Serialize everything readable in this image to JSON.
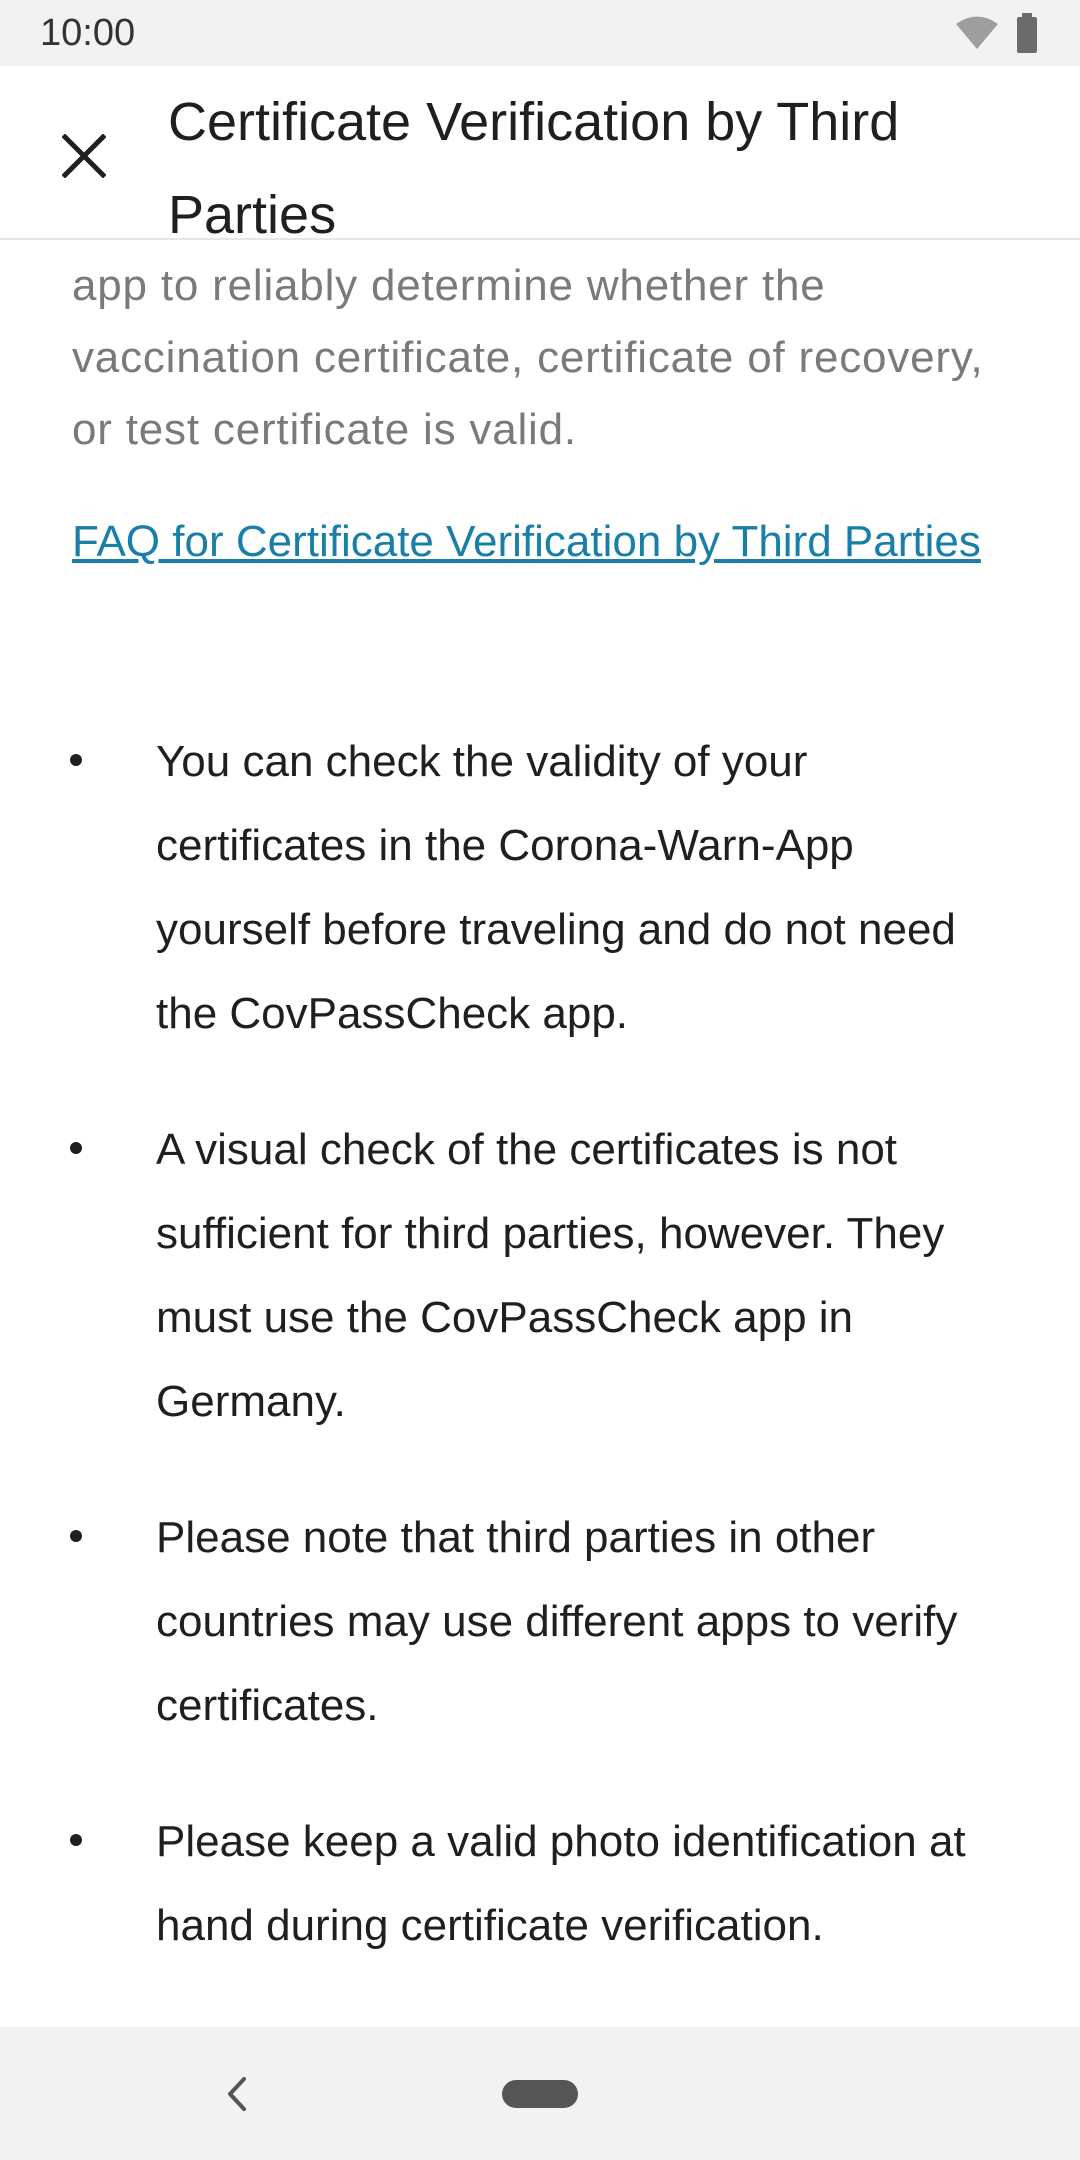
{
  "status_bar": {
    "time": "10:00",
    "icons": [
      "wifi-icon",
      "battery-icon"
    ]
  },
  "app_bar": {
    "close_icon": "close-icon",
    "title": "Certificate Verification by Third Parties"
  },
  "content": {
    "intro_text": "app to reliably determine whether the vaccination certificate, certificate of recovery, or test certificate is valid.",
    "faq_link": "FAQ for Certificate Verification by Third Parties",
    "bullets": [
      "You can check the validity of your certificates in the Corona-Warn-App yourself before traveling and do not need the CovPassCheck app.",
      "A visual check of the certificates is not sufficient for third parties, however. They must use the CovPassCheck app in Germany.",
      "Please note that third parties in other countries may use different apps to verify certificates.",
      "Please keep a valid photo identification at hand during certificate verification."
    ]
  },
  "nav_bar": {
    "back_icon": "back-chevron-icon",
    "home_icon": "home-pill-icon"
  },
  "colors": {
    "link": "#1a7fa8",
    "text": "#1f1f1f",
    "muted_text": "#7a7a7a",
    "system_bar": "#f2f2f2"
  }
}
